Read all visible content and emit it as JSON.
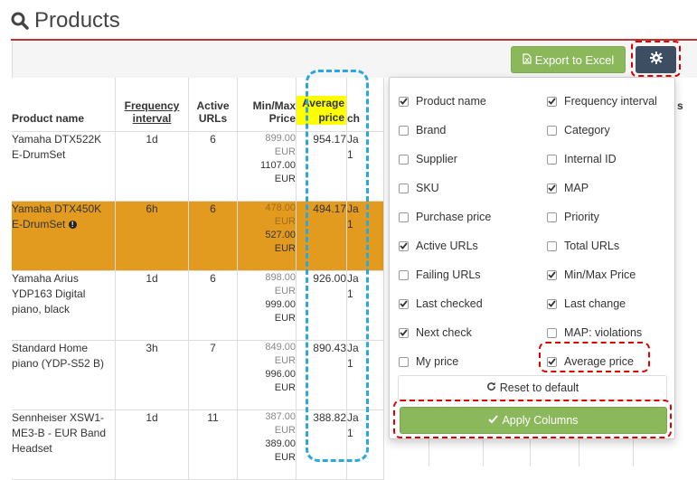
{
  "page": {
    "title": "Products"
  },
  "toolbar": {
    "export_label": "Export to Excel"
  },
  "table": {
    "columns": {
      "name": "Product name",
      "frequency": "Frequency interval",
      "active_urls": "Active URLs",
      "minmax": "Min/Max Price",
      "average": "Average price",
      "next_partial": "ch"
    },
    "rows": [
      {
        "name": "Yamaha DTX522K E-DrumSet",
        "freq": "1d",
        "urls": "6",
        "min": "899.00",
        "min_cur": "EUR",
        "max": "1107.00",
        "max_cur": "EUR",
        "avg": "954.17",
        "next": "Ja",
        "next2": "1"
      },
      {
        "name": "Yamaha DTX450K E-DrumSet",
        "info": "!",
        "freq": "6h",
        "urls": "6",
        "min": "478.00",
        "min_cur": "EUR",
        "max": "527.00",
        "max_cur": "EUR",
        "avg": "494.17",
        "next": "Ja",
        "next2": "1"
      },
      {
        "name": "Yamaha Arius YDP163 Digital piano, black",
        "freq": "1d",
        "urls": "6",
        "min": "898.00",
        "min_cur": "EUR",
        "max": "999.00",
        "max_cur": "EUR",
        "avg": "926.00",
        "next": "Ja",
        "next2": "1"
      },
      {
        "name": "Standard Home piano (YDP-S52 B)",
        "freq": "3h",
        "urls": "7",
        "min": "849.00",
        "min_cur": "EUR",
        "max": "996.00",
        "max_cur": "EUR",
        "avg": "890.43",
        "next": "Ja",
        "next2": "1"
      },
      {
        "name": "Sennheiser XSW1-ME3-B - EUR Band Headset",
        "freq": "1d",
        "urls": "11",
        "min": "387.00",
        "min_cur": "EUR",
        "max": "389.00",
        "max_cur": "EUR",
        "avg": "388.82",
        "next": "Ja",
        "next2": "1"
      }
    ]
  },
  "column_picker": {
    "options": [
      {
        "label": "Product name",
        "checked": true
      },
      {
        "label": "Frequency interval",
        "checked": true
      },
      {
        "label": "Brand",
        "checked": false
      },
      {
        "label": "Category",
        "checked": false
      },
      {
        "label": "Supplier",
        "checked": false
      },
      {
        "label": "Internal ID",
        "checked": false
      },
      {
        "label": "SKU",
        "checked": false
      },
      {
        "label": "MAP",
        "checked": true
      },
      {
        "label": "Purchase price",
        "checked": false
      },
      {
        "label": "Priority",
        "checked": false
      },
      {
        "label": "Active URLs",
        "checked": true
      },
      {
        "label": "Total URLs",
        "checked": false
      },
      {
        "label": "Failing URLs",
        "checked": false
      },
      {
        "label": "Min/Max Price",
        "checked": true
      },
      {
        "label": "Last checked",
        "checked": true
      },
      {
        "label": "Last change",
        "checked": true
      },
      {
        "label": "Next check",
        "checked": true
      },
      {
        "label": "MAP: violations",
        "checked": false
      },
      {
        "label": "My price",
        "checked": false
      },
      {
        "label": "Average price",
        "checked": true
      }
    ],
    "reset_label": "Reset to default",
    "apply_label": "Apply Columns"
  },
  "partial_header": "s",
  "colors": {
    "accent_green": "#8cb85c",
    "gear_bg": "#3d4e63",
    "highlight_row": "#e29a1f",
    "title_rule": "#bb3333"
  }
}
